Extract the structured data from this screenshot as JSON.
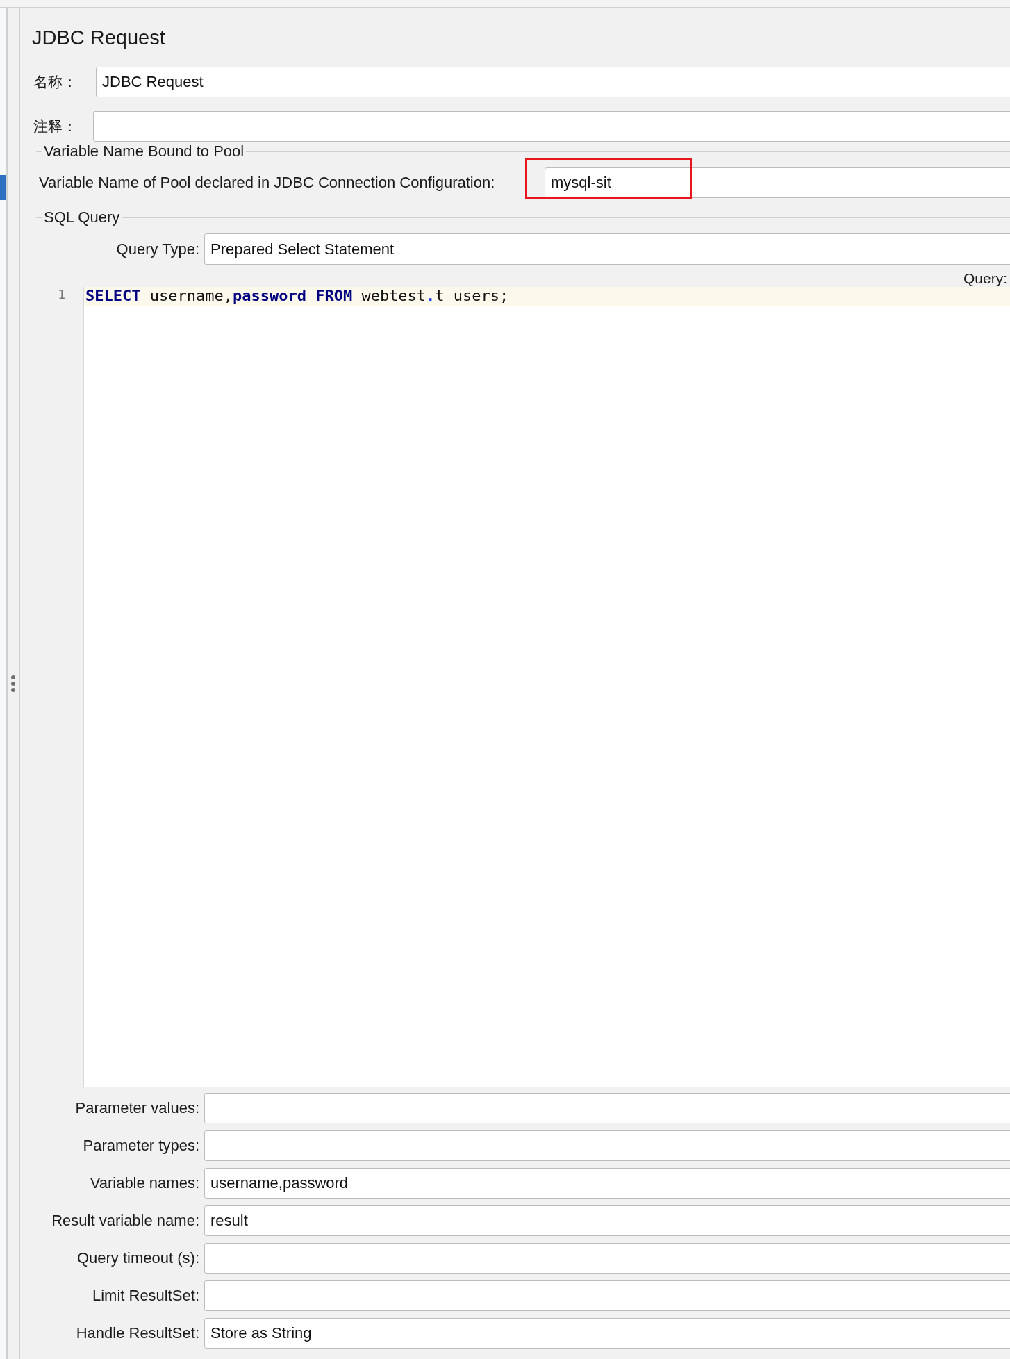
{
  "title": "JDBC Request",
  "name_field": {
    "label": "名称：",
    "value": "JDBC Request"
  },
  "comment_field": {
    "label": "注释："
  },
  "pool_section": {
    "title": "Variable Name Bound to Pool",
    "label": "Variable Name of Pool declared in JDBC Connection Configuration:",
    "value": "mysql-sit",
    "highlighted": true
  },
  "sql_section": {
    "title": "SQL Query",
    "query_type_label": "Query Type:",
    "query_type": "Prepared Select Statement",
    "query_label": "Query:",
    "lines": [
      {
        "number": "1",
        "tokens": [
          {
            "text": "SELECT",
            "kind": "keyword"
          },
          {
            "text": " username,",
            "kind": "plain"
          },
          {
            "text": "password",
            "kind": "keyword"
          },
          {
            "text": " FROM",
            "kind": "keyword"
          },
          {
            "text": " webtest",
            "kind": "plain"
          },
          {
            "text": ".",
            "kind": "operator"
          },
          {
            "text": "t_users;",
            "kind": "plain"
          }
        ]
      }
    ]
  },
  "fields": [
    {
      "label": "Parameter values:"
    },
    {
      "label": "Parameter types:"
    },
    {
      "label": "Variable names:",
      "value": "username,password"
    },
    {
      "label": "Result variable name:",
      "value": "result"
    },
    {
      "label": "Query timeout (s):"
    },
    {
      "label": "Limit ResultSet:"
    },
    {
      "label": "Handle ResultSet:",
      "value": "Store as String"
    }
  ]
}
